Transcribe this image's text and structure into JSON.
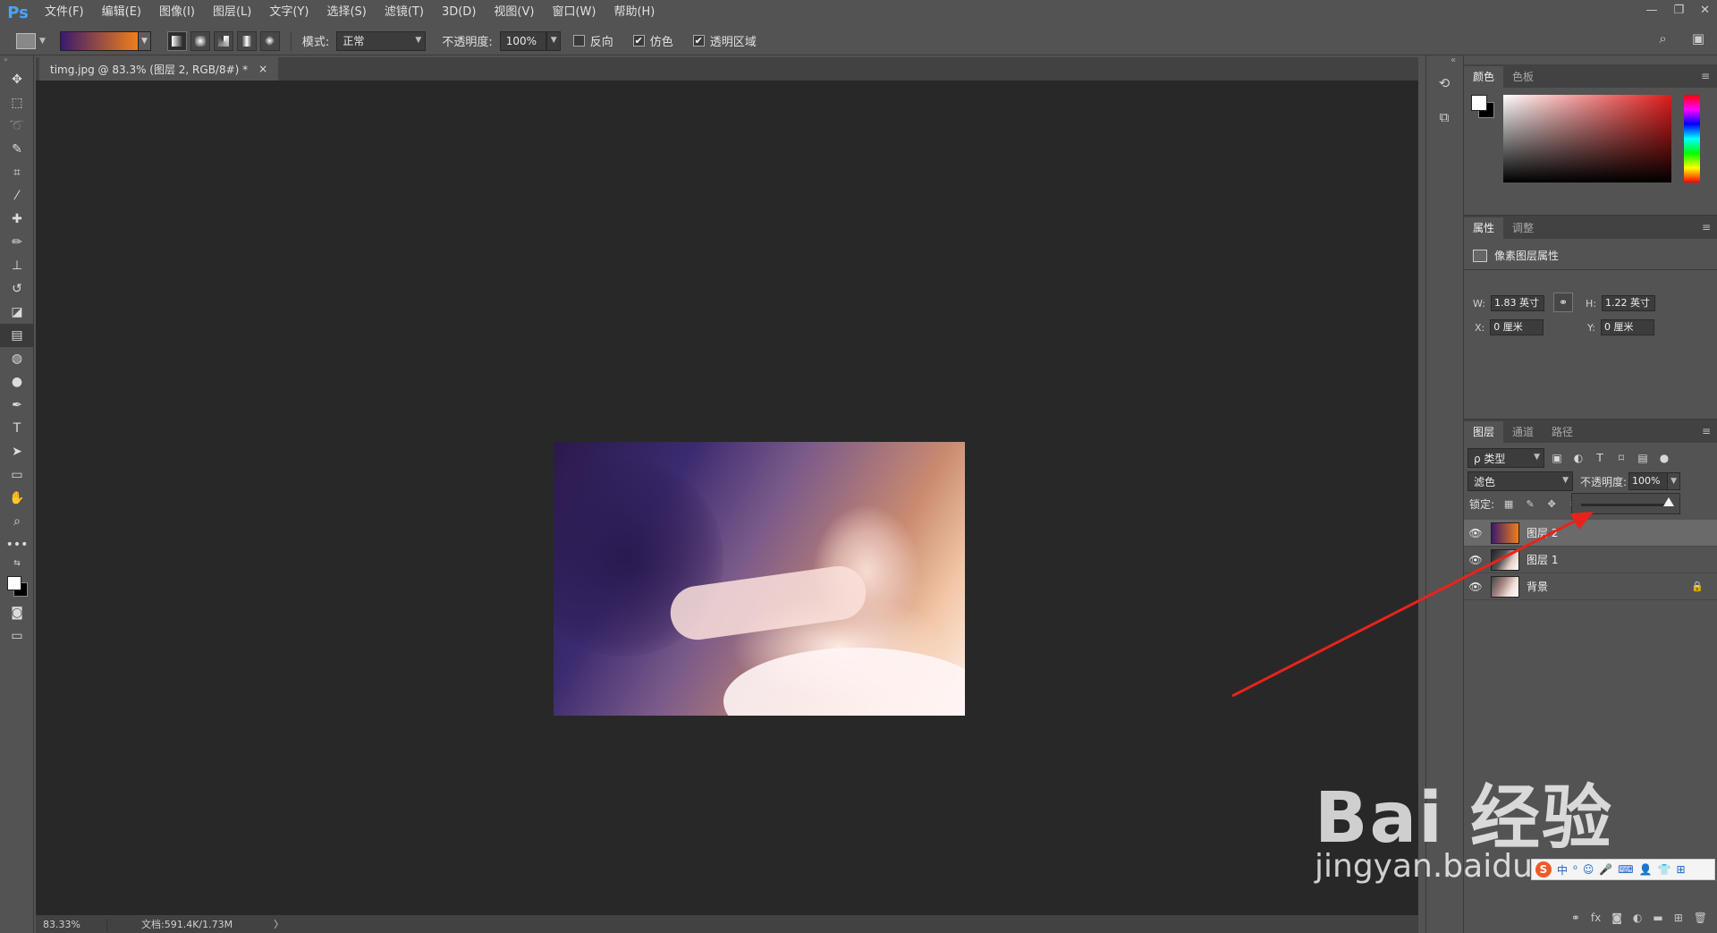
{
  "app": {
    "logo": "Ps"
  },
  "menu": [
    "文件(F)",
    "编辑(E)",
    "图像(I)",
    "图层(L)",
    "文字(Y)",
    "选择(S)",
    "滤镜(T)",
    "3D(D)",
    "视图(V)",
    "窗口(W)",
    "帮助(H)"
  ],
  "options": {
    "mode_label": "模式:",
    "mode_value": "正常",
    "opacity_label": "不透明度:",
    "opacity_value": "100%",
    "reverse_label": "反向",
    "reverse_checked": false,
    "dither_label": "仿色",
    "dither_checked": true,
    "transparency_label": "透明区域",
    "transparency_checked": true,
    "gradient_colors": [
      "#3a1a6e",
      "#f07f1a"
    ]
  },
  "document": {
    "tab_title": "timg.jpg @ 83.3% (图层 2, RGB/8#) *",
    "close_glyph": "×"
  },
  "status": {
    "zoom": "83.33%",
    "doc_info": "文档:591.4K/1.73M",
    "arrow": "〉"
  },
  "color_panel": {
    "tabs": [
      "颜色",
      "色板"
    ]
  },
  "props_panel": {
    "tabs": [
      "属性",
      "调整"
    ],
    "title": "像素图层属性",
    "w_label": "W:",
    "w_value": "1.83 英寸",
    "h_label": "H:",
    "h_value": "1.22 英寸",
    "x_label": "X:",
    "x_value": "0 厘米",
    "y_label": "Y:",
    "y_value": "0 厘米"
  },
  "layers_panel": {
    "tabs": [
      "图层",
      "通道",
      "路径"
    ],
    "kind_filter": "ρ 类型",
    "blend_mode": "滤色",
    "opacity_label": "不透明度:",
    "opacity_value": "100%",
    "opacity_slider_value": 100,
    "lock_label": "锁定:",
    "layers": [
      {
        "name": "图层 2",
        "visible": true,
        "selected": true,
        "thumb": "gradient"
      },
      {
        "name": "图层 1",
        "visible": true,
        "selected": false,
        "thumb": "photo"
      },
      {
        "name": "背景",
        "visible": true,
        "selected": false,
        "thumb": "photo",
        "locked": true
      }
    ]
  },
  "watermark": {
    "brand": "Bai  经验",
    "url": "jingyan.baidu.com"
  },
  "ime": {
    "label": "中"
  },
  "annotation": {
    "arrow_color": "#e8231b"
  }
}
